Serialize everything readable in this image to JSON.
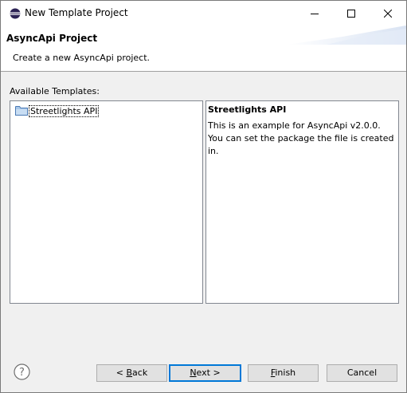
{
  "window": {
    "title": "New Template Project",
    "icon": "eclipse-icon",
    "controls": [
      "minimize-icon",
      "maximize-icon",
      "close-icon"
    ]
  },
  "banner": {
    "title": "AsyncApi Project",
    "description": "Create a new AsyncApi project."
  },
  "templates": {
    "label": "Available Templates:",
    "items": [
      {
        "label": "Streetlights API",
        "icon": "folder-icon",
        "selected": true
      }
    ]
  },
  "details": {
    "title": "Streetlights API",
    "body": "This is an example for AsyncApi v2.0.0. You can set the package the file is created in."
  },
  "buttons": {
    "help_icon": "help-icon",
    "back": {
      "prefix": "< ",
      "mnemonic": "B",
      "rest": "ack"
    },
    "next": {
      "mnemonic": "N",
      "rest": "ext >"
    },
    "finish": {
      "mnemonic": "F",
      "rest": "inish"
    },
    "cancel": "Cancel"
  },
  "colors": {
    "accent": "#0078d7",
    "window_bg": "#f0f0f0",
    "button_bg": "#e1e1e1"
  }
}
